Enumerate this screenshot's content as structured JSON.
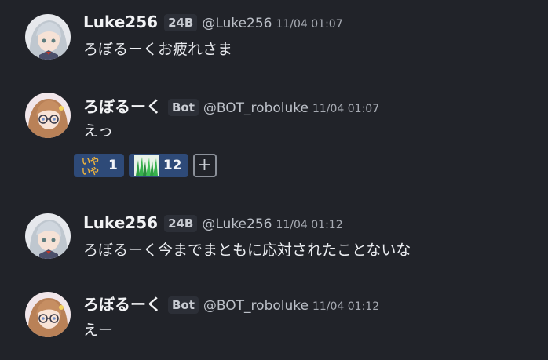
{
  "messages": [
    {
      "name": "Luke256",
      "badge": "24B",
      "handle": "@Luke256",
      "time": "11/04 01:07",
      "text": "ろぼるーくお疲れさま",
      "avatar": "avatar-silver-hair"
    },
    {
      "name": "ろぼるーく",
      "badge": "Bot",
      "handle": "@BOT_roboluke",
      "time": "11/04 01:07",
      "text": "えっ",
      "avatar": "avatar-brown-hair-glasses",
      "reactions": [
        {
          "emoji": "iya-iya-emoji",
          "emoji_text": "いやいや",
          "count": "1"
        },
        {
          "emoji": "grass-emoji",
          "count": "12"
        }
      ],
      "add_reaction_label": "+"
    },
    {
      "name": "Luke256",
      "badge": "24B",
      "handle": "@Luke256",
      "time": "11/04 01:12",
      "text": "ろぼるーく今までまともに応対されたことないな",
      "avatar": "avatar-silver-hair"
    },
    {
      "name": "ろぼるーく",
      "badge": "Bot",
      "handle": "@BOT_roboluke",
      "time": "11/04 01:12",
      "text": "えー",
      "avatar": "avatar-brown-hair-glasses"
    }
  ],
  "colors": {
    "background": "#212329",
    "reaction_bg": "#2e4a78",
    "badge_bg": "#2c2f37"
  }
}
